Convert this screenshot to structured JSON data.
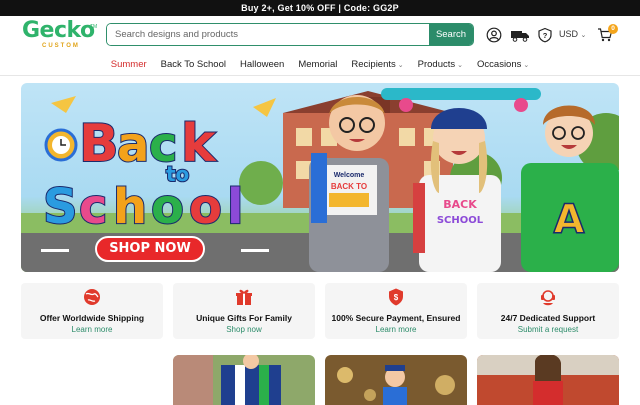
{
  "promo": {
    "text": "Buy 2+, Get 10% OFF | Code: GG2P"
  },
  "brand": {
    "name": "Gecko",
    "sub": "CUSTOM",
    "tm": "TM"
  },
  "search": {
    "placeholder": "Search designs and products",
    "button": "Search"
  },
  "header": {
    "currency": "USD",
    "cart_count": "0"
  },
  "nav": [
    {
      "label": "Summer",
      "active": true
    },
    {
      "label": "Back To School"
    },
    {
      "label": "Halloween"
    },
    {
      "label": "Memorial"
    },
    {
      "label": "Recipients",
      "dropdown": true
    },
    {
      "label": "Products",
      "dropdown": true
    },
    {
      "label": "Occasions",
      "dropdown": true
    }
  ],
  "hero": {
    "title_line1": "Back",
    "title_line2": "to",
    "title_line3": "School",
    "cta": "SHOP NOW",
    "shirt_text": "Welcome BACK TO SCHOOL"
  },
  "features": [
    {
      "icon": "globe-icon",
      "title": "Offer Worldwide Shipping",
      "link": "Learn more"
    },
    {
      "icon": "gift-icon",
      "title": "Unique Gifts For Family",
      "link": "Shop now"
    },
    {
      "icon": "shield-icon",
      "title": "100% Secure Payment, Ensured",
      "link": "Learn more"
    },
    {
      "icon": "support-icon",
      "title": "24/7 Dedicated Support",
      "link": "Submit a request"
    }
  ],
  "colors": {
    "accent": "#2c8c6a",
    "active_nav": "#d42d2d",
    "cta": "#e8282a",
    "badge": "#f4a51c"
  }
}
